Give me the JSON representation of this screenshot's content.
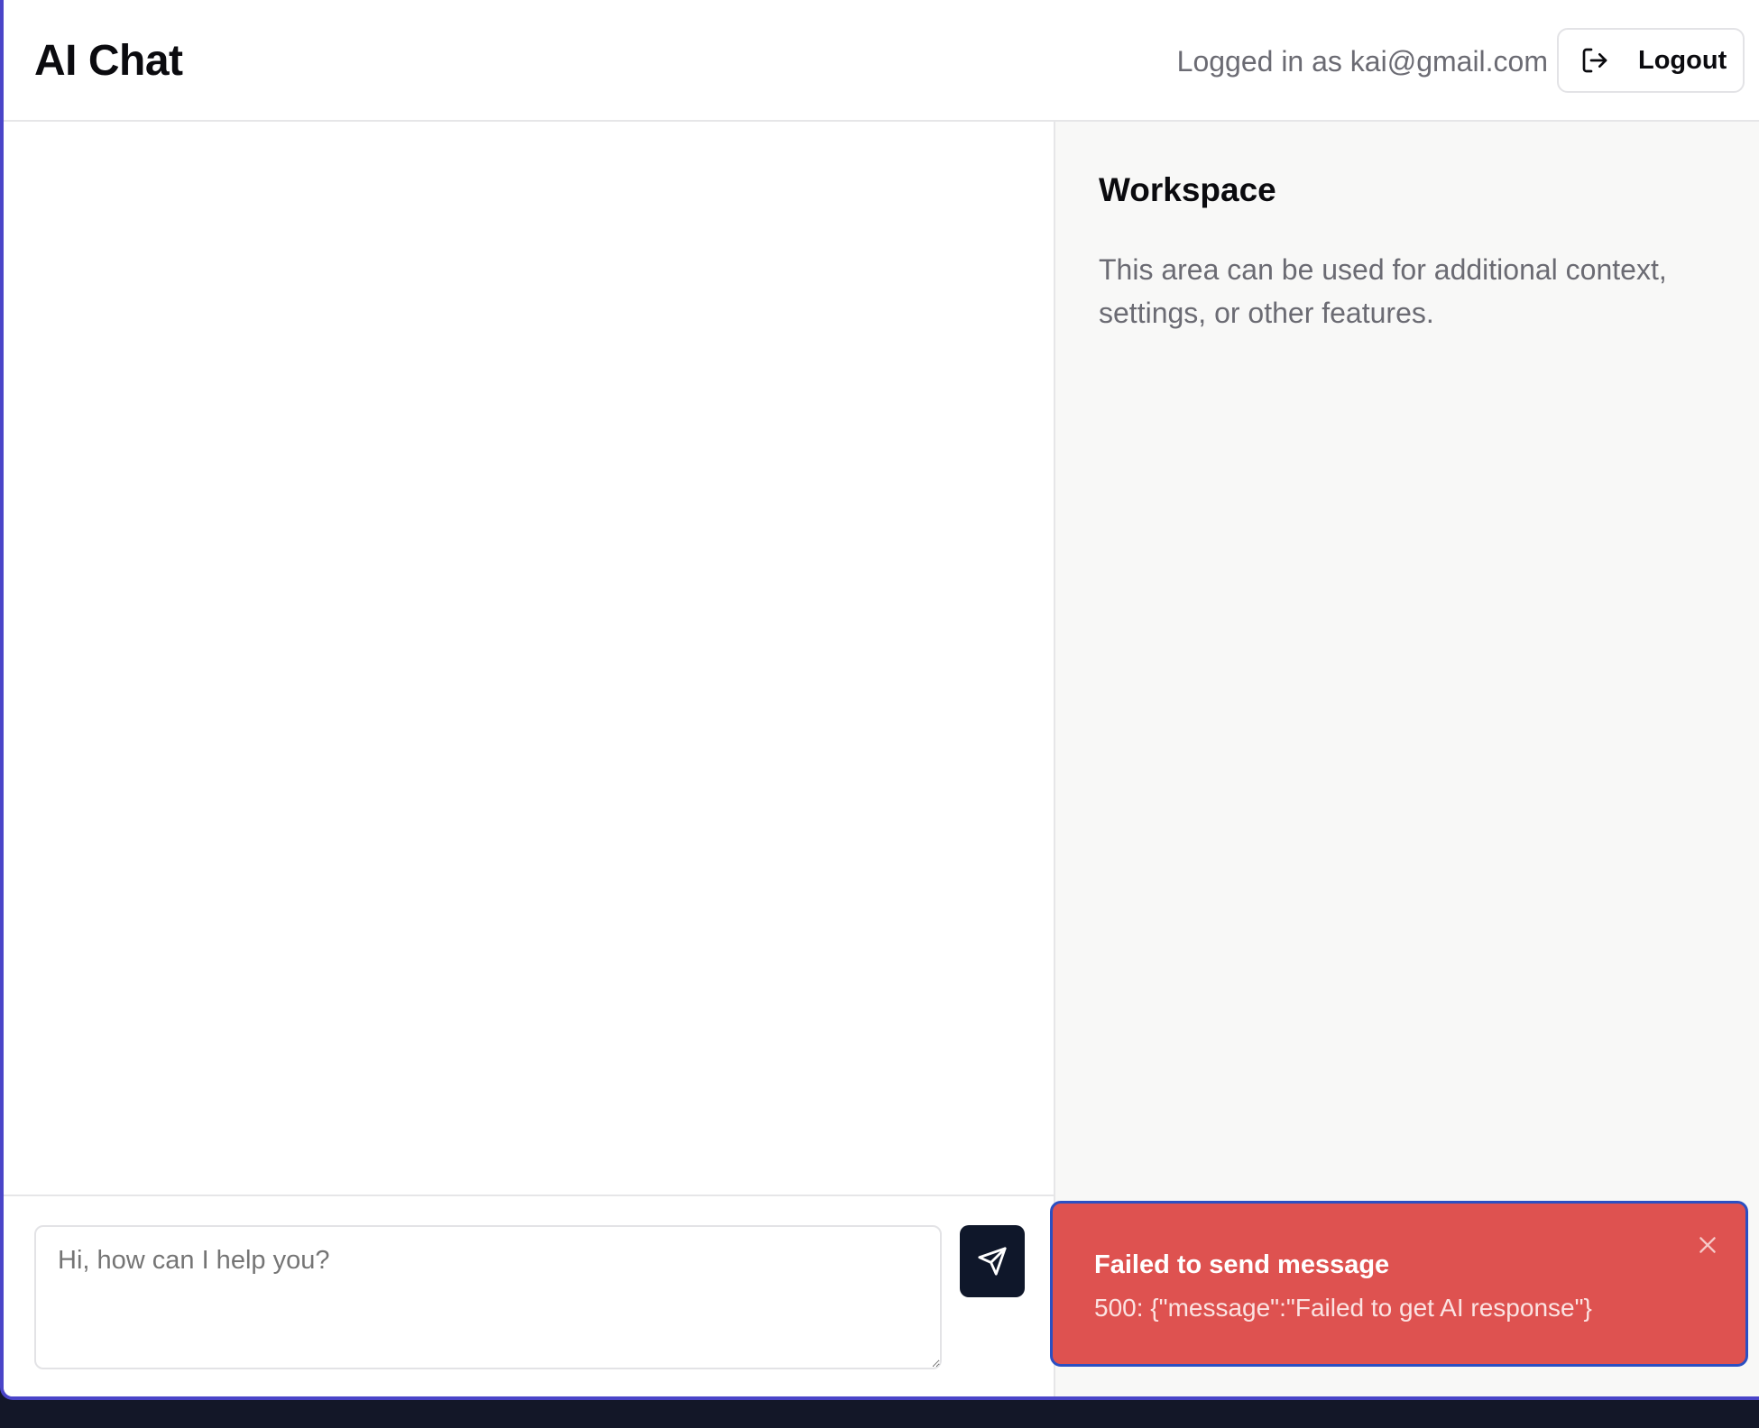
{
  "header": {
    "title": "AI Chat",
    "logged_in_text": "Logged in as kai@gmail.com",
    "logout_label": "Logout",
    "logout_icon": "logout-icon"
  },
  "workspace": {
    "title": "Workspace",
    "description": "This area can be used for additional context, settings, or other features."
  },
  "composer": {
    "input_placeholder": "Hi, how can I help you?",
    "input_value": "",
    "send_icon": "send-icon"
  },
  "toast": {
    "title": "Failed to send message",
    "message": "500: {\"message\":\"Failed to get AI response\"}",
    "close_icon": "close-icon"
  },
  "colors": {
    "accent_border": "#4a45c8",
    "send_button": "#0f172a",
    "toast_background": "#de5250",
    "toast_border": "#2b4fc2",
    "workspace_background": "#f8f8f7"
  }
}
